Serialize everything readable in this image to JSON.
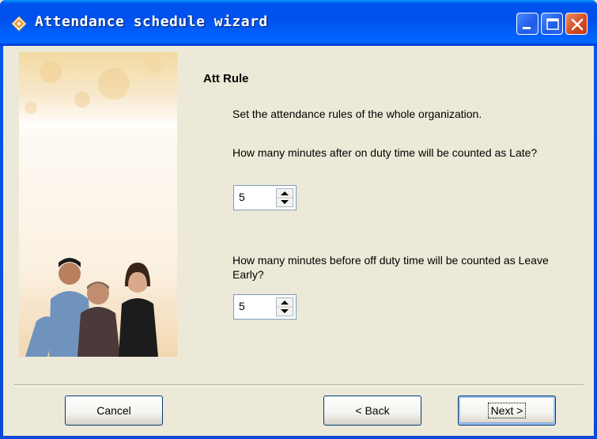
{
  "window": {
    "title": "Attendance schedule wizard"
  },
  "rule": {
    "title": "Att Rule",
    "description": "Set the attendance rules of the whole organization.",
    "late_question": "How many minutes after on duty time will be counted as Late?",
    "late_value": "5",
    "early_question": "How many minutes before off duty time will be counted as Leave Early?",
    "early_value": "5"
  },
  "buttons": {
    "cancel": "Cancel",
    "back": "< Back",
    "next": "Next >"
  },
  "colors": {
    "titlebar": "#0053ee",
    "dialog_bg": "#ece9d8",
    "close_button": "#d2481f"
  },
  "icons": {
    "app": "wizard-app-icon",
    "minimize": "minimize-icon",
    "maximize": "maximize-icon",
    "close": "close-icon",
    "spinner": "spinner-arrows-icon"
  }
}
